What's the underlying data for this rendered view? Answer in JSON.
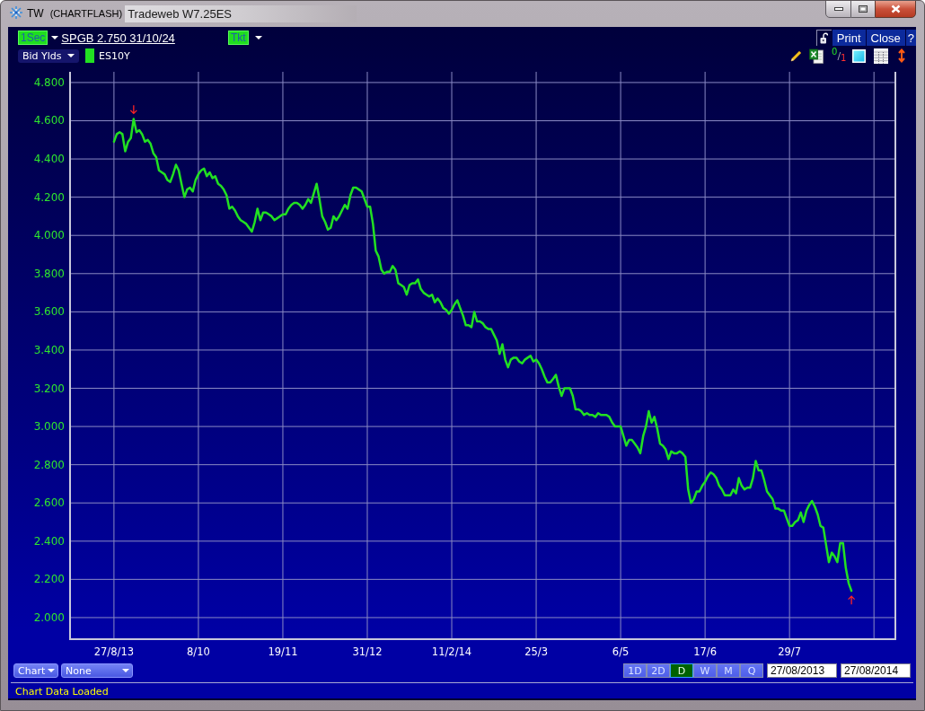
{
  "window": {
    "title": "TW",
    "mode": "(CHARTFLASH)",
    "subtitle": "Tradeweb W7.25ES"
  },
  "toolbar": {
    "interval": "1Sec",
    "instrument": "SPGB 2.750 31/10/24",
    "ticket": "Tkt",
    "buttons": [
      "Print",
      "Close",
      "?"
    ]
  },
  "series_bar": {
    "measure": "Bid Ylds",
    "decimal_toggle": "$^{0}$/$_{1}$"
  },
  "chart": {
    "chart_data": {
      "type": "line",
      "grid": true,
      "categories": [
        "27/8/13",
        null,
        null,
        null,
        null,
        null,
        null,
        null,
        null,
        null,
        null,
        null,
        null,
        null,
        null,
        null,
        null,
        null,
        null,
        null,
        null,
        null,
        null,
        null,
        null,
        null,
        null,
        null,
        null,
        null,
        "8/10",
        null,
        null,
        null,
        null,
        null,
        null,
        null,
        null,
        null,
        null,
        null,
        null,
        null,
        null,
        null,
        null,
        null,
        null,
        null,
        null,
        null,
        null,
        null,
        null,
        null,
        null,
        null,
        null,
        null,
        "19/11",
        null,
        null,
        null,
        null,
        null,
        null,
        null,
        null,
        null,
        null,
        null,
        null,
        null,
        null,
        null,
        null,
        null,
        null,
        null,
        null,
        null,
        null,
        null,
        null,
        null,
        null,
        null,
        null,
        null,
        "31/12",
        null,
        null,
        null,
        null,
        null,
        null,
        null,
        null,
        null,
        null,
        null,
        null,
        null,
        null,
        null,
        null,
        null,
        null,
        null,
        null,
        null,
        null,
        null,
        null,
        null,
        null,
        null,
        null,
        null,
        "11/2/14",
        null,
        null,
        null,
        null,
        null,
        null,
        null,
        null,
        null,
        null,
        null,
        null,
        null,
        null,
        null,
        null,
        null,
        null,
        null,
        null,
        null,
        null,
        null,
        null,
        null,
        null,
        null,
        null,
        null,
        "25/3",
        null,
        null,
        null,
        null,
        null,
        null,
        null,
        null,
        null,
        null,
        null,
        null,
        null,
        null,
        null,
        null,
        null,
        null,
        null,
        null,
        null,
        null,
        null,
        null,
        null,
        null,
        null,
        null,
        null,
        "6/5",
        null,
        null,
        null,
        null,
        null,
        null,
        null,
        null,
        null,
        null,
        null,
        null,
        null,
        null,
        null,
        null,
        null,
        null,
        null,
        null,
        null,
        null,
        null,
        null,
        null,
        null,
        null,
        null,
        null,
        "17/6",
        null,
        null,
        null,
        null,
        null,
        null,
        null,
        null,
        null,
        null,
        null,
        null,
        null,
        null,
        null,
        null,
        null,
        null,
        null,
        null,
        null,
        null,
        null,
        null,
        null,
        null,
        null,
        null,
        null,
        "29/7",
        null,
        null,
        null,
        null,
        null,
        null,
        null,
        null,
        null,
        null,
        null,
        null,
        null,
        null,
        null,
        null,
        null,
        null,
        null,
        null,
        null,
        null
      ],
      "series": [
        {
          "name": "ES10Y",
          "color": "#22e022",
          "values": [
            4.49,
            4.53,
            4.54,
            4.53,
            4.44,
            4.49,
            4.51,
            4.61,
            4.54,
            4.55,
            4.53,
            4.49,
            4.5,
            4.48,
            4.43,
            4.41,
            4.34,
            4.33,
            4.32,
            4.29,
            4.28,
            4.32,
            4.37,
            4.34,
            4.27,
            4.2,
            4.24,
            4.25,
            4.23,
            4.29,
            4.32,
            4.34,
            4.35,
            4.31,
            4.33,
            4.3,
            4.31,
            4.27,
            4.26,
            4.24,
            4.21,
            4.14,
            4.15,
            4.13,
            4.1,
            4.08,
            4.07,
            4.06,
            4.04,
            4.02,
            4.07,
            4.14,
            4.08,
            4.12,
            4.12,
            4.11,
            4.1,
            4.08,
            4.09,
            4.1,
            4.11,
            4.11,
            4.14,
            4.16,
            4.17,
            4.17,
            4.16,
            4.14,
            4.16,
            4.19,
            4.17,
            4.22,
            4.27,
            4.19,
            4.1,
            4.07,
            4.03,
            4.04,
            4.1,
            4.08,
            4.1,
            4.13,
            4.16,
            4.14,
            4.21,
            4.25,
            4.25,
            4.24,
            4.23,
            4.19,
            4.15,
            4.15,
            4.06,
            3.92,
            3.89,
            3.82,
            3.8,
            3.81,
            3.81,
            3.84,
            3.82,
            3.75,
            3.74,
            3.73,
            3.69,
            3.74,
            3.75,
            3.75,
            3.77,
            3.72,
            3.7,
            3.69,
            3.68,
            3.69,
            3.65,
            3.67,
            3.65,
            3.62,
            3.61,
            3.59,
            3.61,
            3.64,
            3.66,
            3.62,
            3.58,
            3.53,
            3.53,
            3.52,
            3.6,
            3.55,
            3.55,
            3.54,
            3.52,
            3.51,
            3.51,
            3.48,
            3.45,
            3.38,
            3.43,
            3.35,
            3.31,
            3.35,
            3.36,
            3.36,
            3.34,
            3.33,
            3.35,
            3.36,
            3.37,
            3.34,
            3.35,
            3.33,
            3.3,
            3.26,
            3.23,
            3.23,
            3.25,
            3.27,
            3.21,
            3.16,
            3.2,
            3.2,
            3.2,
            3.16,
            3.09,
            3.09,
            3.08,
            3.06,
            3.07,
            3.06,
            3.06,
            3.05,
            3.07,
            3.06,
            3.06,
            3.06,
            3.05,
            3.02,
            3.0,
            3.0,
            3.0,
            2.95,
            2.9,
            2.93,
            2.93,
            2.91,
            2.89,
            2.86,
            2.95,
            3.0,
            3.08,
            3.02,
            3.05,
            2.99,
            2.91,
            2.9,
            2.88,
            2.83,
            2.87,
            2.86,
            2.86,
            2.87,
            2.86,
            2.84,
            2.67,
            2.6,
            2.62,
            2.66,
            2.66,
            2.69,
            2.71,
            2.74,
            2.76,
            2.75,
            2.73,
            2.69,
            2.67,
            2.64,
            2.64,
            2.64,
            2.67,
            2.65,
            2.73,
            2.69,
            2.67,
            2.68,
            2.68,
            2.73,
            2.82,
            2.77,
            2.77,
            2.72,
            2.66,
            2.64,
            2.62,
            2.57,
            2.57,
            2.56,
            2.56,
            2.52,
            2.48,
            2.48,
            2.5,
            2.51,
            2.55,
            2.5,
            2.56,
            2.59,
            2.61,
            2.58,
            2.54,
            2.48,
            2.47,
            2.38,
            2.29,
            2.34,
            2.32,
            2.29,
            2.39,
            2.39,
            2.26,
            2.18,
            2.14
          ]
        }
      ],
      "ylim": [
        1.887,
        4.856
      ],
      "yticks": [
        {
          "value": 2,
          "label": "2.000"
        },
        {
          "value": 2.2,
          "label": "2.200"
        },
        {
          "value": 2.4,
          "label": "2.400"
        },
        {
          "value": 2.6,
          "label": "2.600"
        },
        {
          "value": 2.8,
          "label": "2.800"
        },
        {
          "value": 3,
          "label": "3.000"
        },
        {
          "value": 3.2,
          "label": "3.200"
        },
        {
          "value": 3.4,
          "label": "3.400"
        },
        {
          "value": 3.6,
          "label": "3.600"
        },
        {
          "value": 3.8,
          "label": "3.800"
        },
        {
          "value": 4,
          "label": "4.000"
        },
        {
          "value": 4.2,
          "label": "4.200"
        },
        {
          "value": 4.4,
          "label": "4.400"
        },
        {
          "value": 4.6,
          "label": "4.600"
        },
        {
          "value": 4.8,
          "label": "4.800"
        }
      ]
    }
  },
  "bottom_bar": {
    "chart_type": "Chart",
    "overlay": "None",
    "periods": [
      {
        "label": "1D",
        "selected": false
      },
      {
        "label": "2D",
        "selected": false
      },
      {
        "label": "D",
        "selected": true
      },
      {
        "label": "W",
        "selected": false
      },
      {
        "label": "M",
        "selected": false
      },
      {
        "label": "Q",
        "selected": false
      }
    ],
    "from_date": "27/08/2013",
    "to_date": "27/08/2014"
  },
  "status_bar": "Chart Data Loaded"
}
